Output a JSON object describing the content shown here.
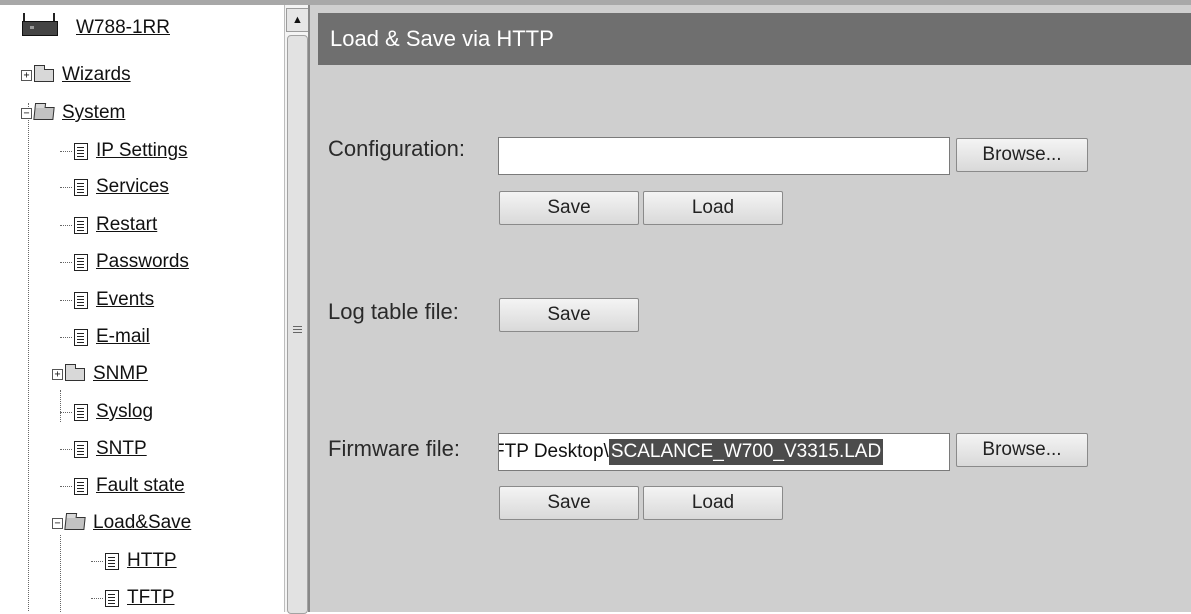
{
  "nav": {
    "device_label": "W788-1RR",
    "wizards": "Wizards",
    "system": "System",
    "ip_settings": "IP Settings",
    "services": "Services",
    "restart": "Restart",
    "passwords": "Passwords",
    "events": "Events",
    "email": "E-mail",
    "snmp": "SNMP",
    "syslog": "Syslog",
    "sntp": "SNTP",
    "fault_state": "Fault state",
    "load_save": "Load&Save",
    "http": "HTTP",
    "tftp": "TFTP"
  },
  "scrollbar": {
    "up_arrow": "▲",
    "thumb_grip": "≡"
  },
  "page": {
    "title": "Load & Save via HTTP",
    "configuration": {
      "label": "Configuration:",
      "value": "",
      "browse": "Browse...",
      "save": "Save",
      "load": "Load"
    },
    "log_table": {
      "label": "Log table file:",
      "save": "Save"
    },
    "firmware": {
      "label": "Firmware file:",
      "value_visible_prefix": "FTP Desktop\\",
      "value_selected": "SCALANCE_W700_V3315.LAD",
      "browse": "Browse...",
      "save": "Save",
      "load": "Load"
    }
  },
  "colors": {
    "header_bg": "#6f6f6f",
    "panel_bg": "#cfcfcf",
    "selection_bg": "#4c4c4c"
  }
}
